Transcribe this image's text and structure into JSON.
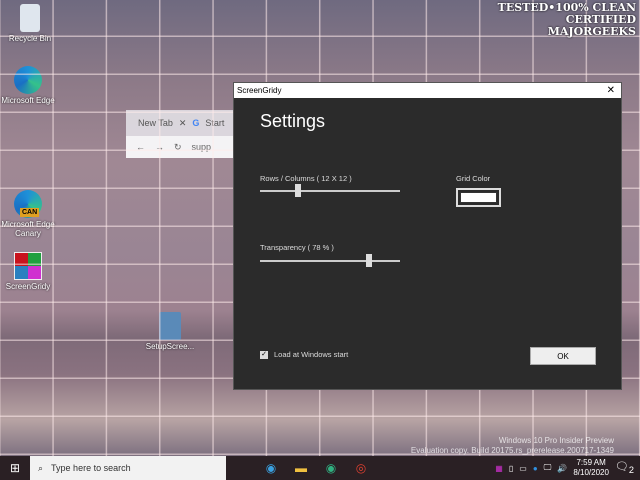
{
  "desktop": {
    "icons": [
      {
        "label": "Recycle Bin"
      },
      {
        "label": "Microsoft Edge"
      },
      {
        "label": "Microsoft Edge Canary",
        "badge": "CAN"
      },
      {
        "label": "ScreenGridy"
      },
      {
        "label": "SetupScree..."
      }
    ]
  },
  "browser": {
    "tab1": "New Tab",
    "tab2": "Start",
    "address": "supp"
  },
  "watermark_logo": "TESTED • 100% CLEAN CERTIFIED MAJORGEEKS",
  "window": {
    "title": "ScreenGridy",
    "heading": "Settings",
    "rows_label": "Rows / Columns  ( 12 X 12 )",
    "rows_value": 12,
    "rows_fraction": 0.27,
    "transparency_label": "Transparency ( 78 % )",
    "transparency_value": 78,
    "transparency_fraction": 0.78,
    "grid_color_label": "Grid Color",
    "grid_color": "#ffffff",
    "load_label": "Load at Windows start",
    "load_checked": true,
    "ok_label": "OK"
  },
  "os_watermark": {
    "line1": "Windows 10 Pro Insider Preview",
    "line2": "Evaluation copy. Build 20175.rs_prerelease.200717-1349"
  },
  "taskbar": {
    "search_placeholder": "Type here to search",
    "time": "7:59 AM",
    "date": "8/10/2020",
    "notifications": "2"
  }
}
